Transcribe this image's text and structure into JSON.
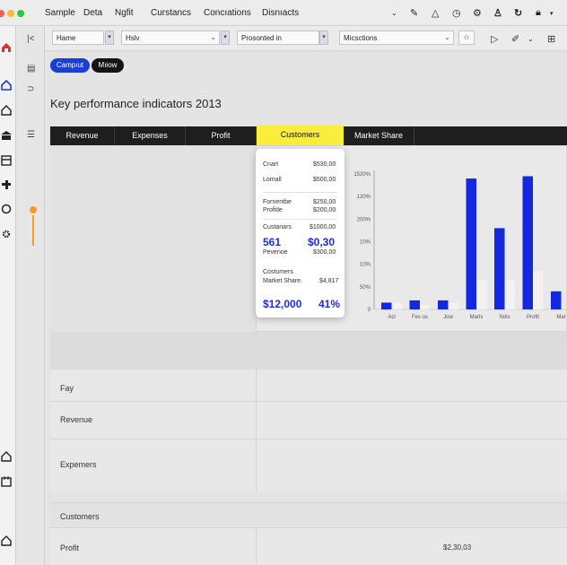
{
  "menubar": {
    "items": [
      "Sample",
      "Deta",
      "Ngfit",
      "Curstancs",
      "Concıations",
      "Disnıacts"
    ]
  },
  "filters": {
    "home_value": "Hame",
    "view_value": "Hslv",
    "range_value": "Prosonted in",
    "metrics_value": "Micsctions"
  },
  "pills": {
    "primary": "Campıut",
    "secondary": "Mıiow"
  },
  "page_title": "Key performance indicators 2013",
  "tabs": [
    "Revenue",
    "Expenses",
    "Profit",
    "Customers",
    "Market Share"
  ],
  "active_tab": "Customers",
  "card": {
    "r1_label": "Cnart",
    "r1_value": "$530,00",
    "r2_label": "Lomall",
    "r2_value": "$500,00",
    "r3_label": "Fornentbe",
    "r3_value": "$250,00",
    "r4_label": "Profitle",
    "r4_value": "$200,00",
    "r5_label": "Custanars",
    "r5_value": "$1000,00",
    "big1_left": "561",
    "big1_right": "$0,30",
    "r6_label": "Pevenoe",
    "r6_value": "$300,00",
    "r7_label": "Costumers",
    "r8_label": "Market Share.",
    "r8_value": "$4,817",
    "big2_left": "$12,000",
    "big2_right": "41%"
  },
  "chart_data": {
    "type": "bar",
    "categories": [
      "Acl",
      "Fes us",
      "Jow",
      "Marls",
      "Nols",
      "Profit",
      "Mar"
    ],
    "series": [
      {
        "color": "#1428e0",
        "values": [
          3,
          4,
          4,
          58,
          36,
          59,
          8
        ]
      },
      {
        "color": "#f2f2f2",
        "values": [
          3,
          2,
          3,
          13,
          13,
          17,
          0
        ]
      }
    ],
    "y_ticks": [
      "1520%",
      "120%",
      "200%",
      "10%",
      "10%",
      "50%",
      "0"
    ],
    "grid": false
  },
  "table": {
    "rows": [
      {
        "label": "Fay",
        "value": ""
      },
      {
        "label": "Revenue",
        "value": ""
      },
      {
        "label": "Expemers",
        "value": ""
      },
      {
        "label": "Customers",
        "value": ""
      },
      {
        "label": "Profit",
        "value": "$2,30,03"
      }
    ]
  },
  "colors": {
    "accent_blue": "#1428e0",
    "tab_active": "#f8ee3b",
    "tab_bar": "#1e1e1e",
    "pill_primary": "#1a3fd6",
    "rail_accent": "#f39a2b",
    "logo_red": "#d9332b"
  },
  "icons": {
    "rail": [
      "logo-icon",
      "home-icon",
      "house-icon",
      "building-icon",
      "window-icon",
      "puzzle-icon",
      "refresh-icon",
      "gear-icon",
      "home-bottom-icon",
      "calendar-icon",
      "bank-icon"
    ],
    "toolbar": [
      "chevron-down-icon",
      "pen-icon",
      "bell-icon",
      "clock-icon",
      "settings-icon",
      "user-icon",
      "cycle-icon",
      "lock-icon",
      "grid-icon"
    ]
  }
}
